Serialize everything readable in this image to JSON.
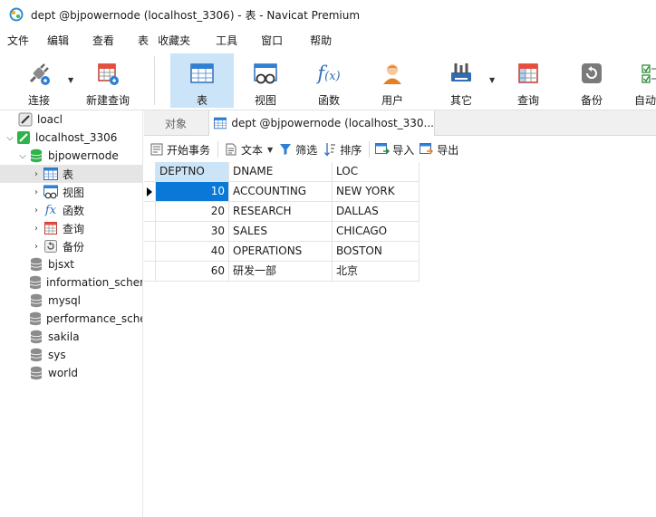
{
  "window": {
    "title": "dept @bjpowernode (localhost_3306) - 表 - Navicat Premium"
  },
  "menu": {
    "items": [
      "文件",
      "编辑",
      "查看",
      "表",
      "收藏夹",
      "工具",
      "窗口",
      "帮助"
    ]
  },
  "toolbar": {
    "buttons": [
      {
        "label": "连接",
        "icon": "plug-icon"
      },
      {
        "label": "新建查询",
        "icon": "new-query-icon"
      },
      {
        "label": "表",
        "icon": "table-icon",
        "active": true
      },
      {
        "label": "视图",
        "icon": "view-icon"
      },
      {
        "label": "函数",
        "icon": "function-icon"
      },
      {
        "label": "用户",
        "icon": "user-icon"
      },
      {
        "label": "其它",
        "icon": "tools-icon"
      },
      {
        "label": "查询",
        "icon": "query-icon"
      },
      {
        "label": "备份",
        "icon": "backup-icon"
      },
      {
        "label": "自动",
        "icon": "automation-icon"
      }
    ],
    "accent": "#cce4f7"
  },
  "nav": {
    "items": [
      {
        "label": "loacl",
        "icon": "connection-icon"
      },
      {
        "label": "localhost_3306",
        "icon": "connection-open-icon"
      },
      {
        "label": "bjpowernode",
        "icon": "database-open-icon"
      },
      {
        "label": "表",
        "icon": "table-icon",
        "selected": true
      },
      {
        "label": "视图",
        "icon": "view-icon"
      },
      {
        "label": "函数",
        "icon": "function-icon"
      },
      {
        "label": "查询",
        "icon": "query-icon"
      },
      {
        "label": "备份",
        "icon": "backup-icon"
      },
      {
        "label": "bjsxt",
        "icon": "database-icon"
      },
      {
        "label": "information_schema",
        "icon": "database-icon"
      },
      {
        "label": "mysql",
        "icon": "database-icon"
      },
      {
        "label": "performance_schema",
        "icon": "database-icon"
      },
      {
        "label": "sakila",
        "icon": "database-icon"
      },
      {
        "label": "sys",
        "icon": "database-icon"
      },
      {
        "label": "world",
        "icon": "database-icon"
      }
    ]
  },
  "tabs": {
    "objects_label": "对象",
    "active_label": "dept @bjpowernode (localhost_330..."
  },
  "subtoolbar": {
    "begin_transaction": "开始事务",
    "text": "文本",
    "filter": "筛选",
    "sort": "排序",
    "import": "导入",
    "export": "导出"
  },
  "grid": {
    "columns": [
      "DEPTNO",
      "DNAME",
      "LOC"
    ],
    "rows": [
      {
        "deptno": "10",
        "dname": "ACCOUNTING",
        "loc": "NEW YORK"
      },
      {
        "deptno": "20",
        "dname": "RESEARCH",
        "loc": "DALLAS"
      },
      {
        "deptno": "30",
        "dname": "SALES",
        "loc": "CHICAGO"
      },
      {
        "deptno": "40",
        "dname": "OPERATIONS",
        "loc": "BOSTON"
      },
      {
        "deptno": "60",
        "dname": "研发一部",
        "loc": "北京"
      }
    ],
    "selected_color": "#0a78d7"
  }
}
